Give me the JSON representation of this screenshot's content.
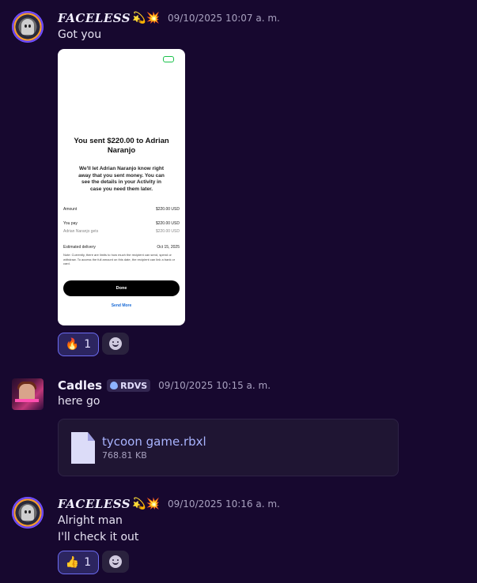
{
  "messages": [
    {
      "author": "FACELESS",
      "author_emojis": "💫💥",
      "timestamp": "09/10/2025 10:07 a. m.",
      "text": "Got you",
      "attachment_image": {
        "title": "You sent $220.00 to Adrian Naranjo",
        "description": "We'll let Adrian Naranjo know right away that you sent money. You can see the details in your Activity in case you need them later.",
        "rows": [
          {
            "label": "Amount",
            "value": "$220.00 USD"
          },
          {
            "label": "You pay",
            "value": "$220.00 USD"
          },
          {
            "label": "Adrian Naranjo gets",
            "value": "$220.00 USD"
          },
          {
            "label": "Estimated delivery",
            "value": "Oct 15, 2025"
          }
        ],
        "note": "Note: Currently, there are limits to how much the recipient can send, spend or withdraw. To access the full amount on this date, the recipient can link a bank or card.",
        "done_label": "Done",
        "send_more_label": "Send More"
      },
      "reaction": {
        "emoji": "🔥",
        "count": "1"
      }
    },
    {
      "author": "Cadles",
      "tag": "RDVS",
      "timestamp": "09/10/2025 10:15 a. m.",
      "text": "here go",
      "file": {
        "name": "tycoon game.rbxl",
        "size": "768.81 KB"
      }
    },
    {
      "author": "FACELESS",
      "author_emojis": "💫💥",
      "timestamp": "09/10/2025 10:16 a. m.",
      "lines": [
        "Alright man",
        "I'll check it out"
      ],
      "reaction": {
        "emoji": "👍",
        "count": "1"
      }
    }
  ]
}
